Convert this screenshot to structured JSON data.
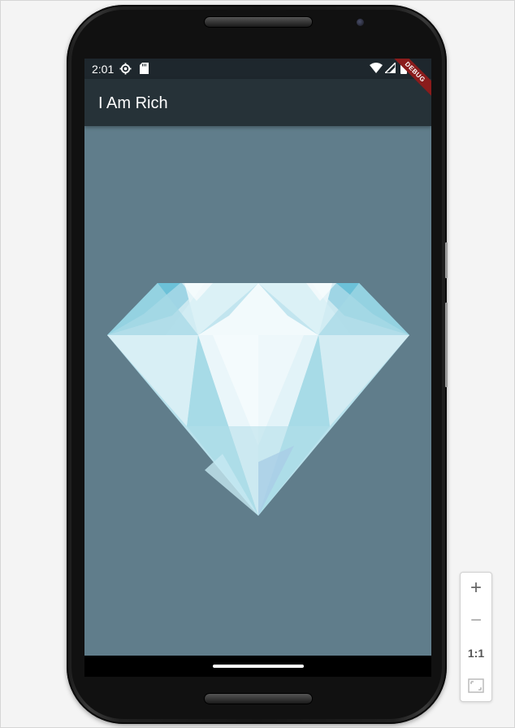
{
  "status_bar": {
    "time": "2:01",
    "icons": [
      "settings-gear-icon",
      "sd-card-icon",
      "wifi-icon",
      "cell-signal-icon",
      "battery-icon"
    ]
  },
  "app_bar": {
    "title": "I Am Rich",
    "background_color": "#263238"
  },
  "body": {
    "background_color": "#607d8b",
    "image": "diamond-image"
  },
  "debug_banner": {
    "label": "DEBUG"
  },
  "zoom_controls": {
    "zoom_in": "+",
    "zoom_out": "−",
    "reset": "1:1",
    "fit_icon": "fit-screen-icon"
  }
}
